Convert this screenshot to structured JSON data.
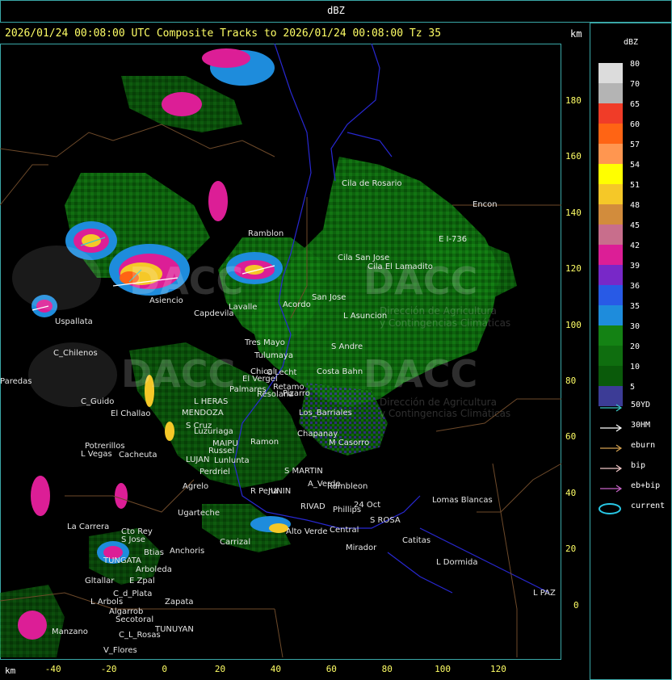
{
  "top_title": "dBZ",
  "header": "2026/01/24 00:08:00 UTC Composite Tracks to 2026/01/24 00:08:00 Tz 35",
  "km_label": "km",
  "legend": {
    "title": "dBZ",
    "scale": [
      {
        "value": "80",
        "color": "#dcdcdc"
      },
      {
        "value": "70",
        "color": "#b4b4b4"
      },
      {
        "value": "65",
        "color": "#f03c28"
      },
      {
        "value": "60",
        "color": "#ff6414"
      },
      {
        "value": "57",
        "color": "#ff9650"
      },
      {
        "value": "54",
        "color": "#ffff00"
      },
      {
        "value": "51",
        "color": "#f5c828"
      },
      {
        "value": "48",
        "color": "#d28c3c"
      },
      {
        "value": "45",
        "color": "#c86e8c"
      },
      {
        "value": "42",
        "color": "#dc1e96"
      },
      {
        "value": "39",
        "color": "#7828c8"
      },
      {
        "value": "36",
        "color": "#285ae6"
      },
      {
        "value": "35",
        "color": "#1e8cdc"
      },
      {
        "value": "30",
        "color": "#148214"
      },
      {
        "value": "20",
        "color": "#0f6e0f"
      },
      {
        "value": "10",
        "color": "#0a5a0a"
      },
      {
        "value": "5",
        "color": "#3c3c96"
      }
    ],
    "tracks": [
      {
        "label": "50YD",
        "color": "#3cc8c8"
      },
      {
        "label": "30HM",
        "color": "#ffffff"
      },
      {
        "label": "eburn",
        "color": "#d2a050"
      },
      {
        "label": "bip",
        "color": "#f0c8c8"
      },
      {
        "label": "eb+bip",
        "color": "#c864c8"
      },
      {
        "label": "current",
        "color": "#28c8e6"
      }
    ]
  },
  "axes": {
    "x_ticks": [
      "-40",
      "-20",
      "0",
      "20",
      "40",
      "60",
      "80",
      "100",
      "120"
    ],
    "y_ticks": [
      "180",
      "160",
      "140",
      "120",
      "100",
      "80",
      "60",
      "40",
      "20",
      "0"
    ],
    "x_label": "km",
    "y_label": "km"
  },
  "places": [
    "Cila de Rosario",
    "Encon",
    "E I-736",
    "Ramblon",
    "Cila San Jose",
    "Cila El Lamadito",
    "Asiencio",
    "Capdevila",
    "San Jose",
    "Lavalle",
    "L Asuncion",
    "Acordo",
    "Uspallata",
    "C_Chilenos",
    "Paredas",
    "Tres Mayo",
    "Tulumaya",
    "Chical",
    "C Lecht",
    "S Andre",
    "El Vergel",
    "Costa Bahn",
    "Retamo",
    "Pizarro",
    "Resolana",
    "Los_Barriales",
    "C_Guido",
    "El Challao",
    "MENDOZA",
    "L HERAS",
    "Palmares",
    "S Cruz",
    "Luzuriaga",
    "Chapanay",
    "Ramon",
    "M Casorro",
    "Potrerillos",
    "L Vegas",
    "Cacheuta",
    "MAIPU",
    "Russel",
    "LUJAN",
    "Lunlunta",
    "Perdriel",
    "S MARTIN",
    "A_Verde",
    "Agrelo",
    "R Pena",
    "JUNIN",
    "Rambleon",
    "Ugarteche",
    "RIVAD",
    "Phillips",
    "24 Oct",
    "S ROSA",
    "Lomas Blancas",
    "La Carrera",
    "Cto Rey",
    "S Jose",
    "TUNGATA",
    "Btias",
    "Anchoris",
    "Carrizal",
    "Alto Verde",
    "Mirador",
    "Central",
    "Catitas",
    "L Dormida",
    "Arboleda",
    "Gltallar",
    "E Zpal",
    "C_d_Plata",
    "L Arbols",
    "Zapata",
    "Algarrob",
    "Secotoral",
    "TUNUYAN",
    "Manzano",
    "C_L_Rosas",
    "V_Flores",
    "L PAZ"
  ],
  "watermark": {
    "logo_text": "DACC",
    "tagline_1": "Dirección de Agricultura",
    "tagline_2": "y Contingencias Climáticas"
  }
}
